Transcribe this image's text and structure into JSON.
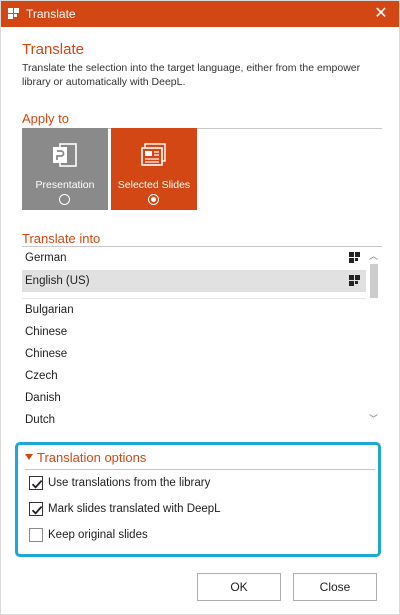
{
  "window": {
    "title": "Translate",
    "close_glyph": "✕",
    "app_icon": "empower-icon",
    "accent_color": "#d24713",
    "highlight_color": "#1ba7d8"
  },
  "header": {
    "title": "Translate",
    "description": "Translate the selection into the target language, either from the empower library or automatically with DeepL."
  },
  "apply_to": {
    "label": "Apply to",
    "options": [
      {
        "label": "Presentation",
        "icon": "powerpoint-icon",
        "selected": false
      },
      {
        "label": "Selected Slides",
        "icon": "slides-icon",
        "selected": true
      }
    ]
  },
  "translate_into": {
    "label": "Translate into",
    "languages": [
      {
        "name": "German",
        "library_icon": true,
        "selected": false
      },
      {
        "name": "English (US)",
        "library_icon": true,
        "selected": true
      },
      {
        "name": "Bulgarian",
        "library_icon": false,
        "selected": false
      },
      {
        "name": "Chinese",
        "library_icon": false,
        "selected": false
      },
      {
        "name": "Chinese",
        "library_icon": false,
        "selected": false
      },
      {
        "name": "Czech",
        "library_icon": false,
        "selected": false
      },
      {
        "name": "Danish",
        "library_icon": false,
        "selected": false
      },
      {
        "name": "Dutch",
        "library_icon": false,
        "selected": false
      }
    ]
  },
  "translation_options": {
    "label": "Translation options",
    "checkboxes": [
      {
        "label": "Use translations from the library",
        "checked": true
      },
      {
        "label": "Mark slides translated with DeepL",
        "checked": true
      },
      {
        "label": "Keep original slides",
        "checked": false
      }
    ]
  },
  "footer": {
    "ok_label": "OK",
    "close_label": "Close"
  }
}
